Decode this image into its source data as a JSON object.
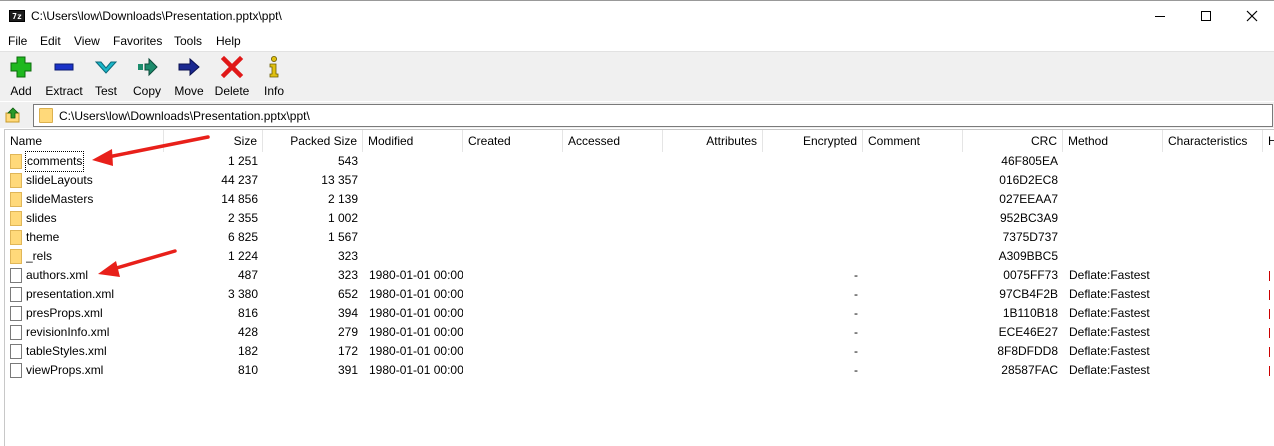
{
  "window": {
    "title": "C:\\Users\\low\\Downloads\\Presentation.pptx\\ppt\\",
    "app_icon_label": "7z"
  },
  "menu": [
    "File",
    "Edit",
    "View",
    "Favorites",
    "Tools",
    "Help"
  ],
  "toolbar": [
    {
      "label": "Add",
      "icon": "add-icon",
      "color": "#1fb81f"
    },
    {
      "label": "Extract",
      "icon": "extract-icon",
      "color": "#1a32c8"
    },
    {
      "label": "Test",
      "icon": "test-icon",
      "color": "#19b6c8"
    },
    {
      "label": "Copy",
      "icon": "copy-icon",
      "color": "#1c8c6c"
    },
    {
      "label": "Move",
      "icon": "move-icon",
      "color": "#1a2890"
    },
    {
      "label": "Delete",
      "icon": "delete-icon",
      "color": "#e01818"
    },
    {
      "label": "Info",
      "icon": "info-icon",
      "color": "#e0c010"
    }
  ],
  "address": {
    "path": "C:\\Users\\low\\Downloads\\Presentation.pptx\\ppt\\"
  },
  "columns": [
    "Name",
    "Size",
    "Packed Size",
    "Modified",
    "Created",
    "Accessed",
    "Attributes",
    "Encrypted",
    "Comment",
    "CRC",
    "Method",
    "Characteristics",
    "H"
  ],
  "rows": [
    {
      "type": "folder",
      "name": "comments",
      "size": "1 251",
      "packed": "543",
      "modified": "",
      "encrypted": "",
      "crc": "46F805EA",
      "method": "",
      "characteristics": ""
    },
    {
      "type": "folder",
      "name": "slideLayouts",
      "size": "44 237",
      "packed": "13 357",
      "modified": "",
      "encrypted": "",
      "crc": "016D2EC8",
      "method": "",
      "characteristics": ""
    },
    {
      "type": "folder",
      "name": "slideMasters",
      "size": "14 856",
      "packed": "2 139",
      "modified": "",
      "encrypted": "",
      "crc": "027EEAA7",
      "method": "",
      "characteristics": ""
    },
    {
      "type": "folder",
      "name": "slides",
      "size": "2 355",
      "packed": "1 002",
      "modified": "",
      "encrypted": "",
      "crc": "952BC3A9",
      "method": "",
      "characteristics": ""
    },
    {
      "type": "folder",
      "name": "theme",
      "size": "6 825",
      "packed": "1 567",
      "modified": "",
      "encrypted": "",
      "crc": "7375D737",
      "method": "",
      "characteristics": ""
    },
    {
      "type": "folder",
      "name": "_rels",
      "size": "1 224",
      "packed": "323",
      "modified": "",
      "encrypted": "",
      "crc": "A309BBC5",
      "method": "",
      "characteristics": ""
    },
    {
      "type": "file",
      "name": "authors.xml",
      "size": "487",
      "packed": "323",
      "modified": "1980-01-01 00:00",
      "encrypted": "-",
      "crc": "0075FF73",
      "method": "Deflate:Fastest",
      "characteristics": ""
    },
    {
      "type": "file",
      "name": "presentation.xml",
      "size": "3 380",
      "packed": "652",
      "modified": "1980-01-01 00:00",
      "encrypted": "-",
      "crc": "97CB4F2B",
      "method": "Deflate:Fastest",
      "characteristics": ""
    },
    {
      "type": "file",
      "name": "presProps.xml",
      "size": "816",
      "packed": "394",
      "modified": "1980-01-01 00:00",
      "encrypted": "-",
      "crc": "1B110B18",
      "method": "Deflate:Fastest",
      "characteristics": ""
    },
    {
      "type": "file",
      "name": "revisionInfo.xml",
      "size": "428",
      "packed": "279",
      "modified": "1980-01-01 00:00",
      "encrypted": "-",
      "crc": "ECE46E27",
      "method": "Deflate:Fastest",
      "characteristics": ""
    },
    {
      "type": "file",
      "name": "tableStyles.xml",
      "size": "182",
      "packed": "172",
      "modified": "1980-01-01 00:00",
      "encrypted": "-",
      "crc": "8F8DFDD8",
      "method": "Deflate:Fastest",
      "characteristics": ""
    },
    {
      "type": "file",
      "name": "viewProps.xml",
      "size": "810",
      "packed": "391",
      "modified": "1980-01-01 00:00",
      "encrypted": "-",
      "crc": "28587FAC",
      "method": "Deflate:Fastest",
      "characteristics": ""
    }
  ],
  "annotations": {
    "arrow_color": "#e8201a"
  }
}
